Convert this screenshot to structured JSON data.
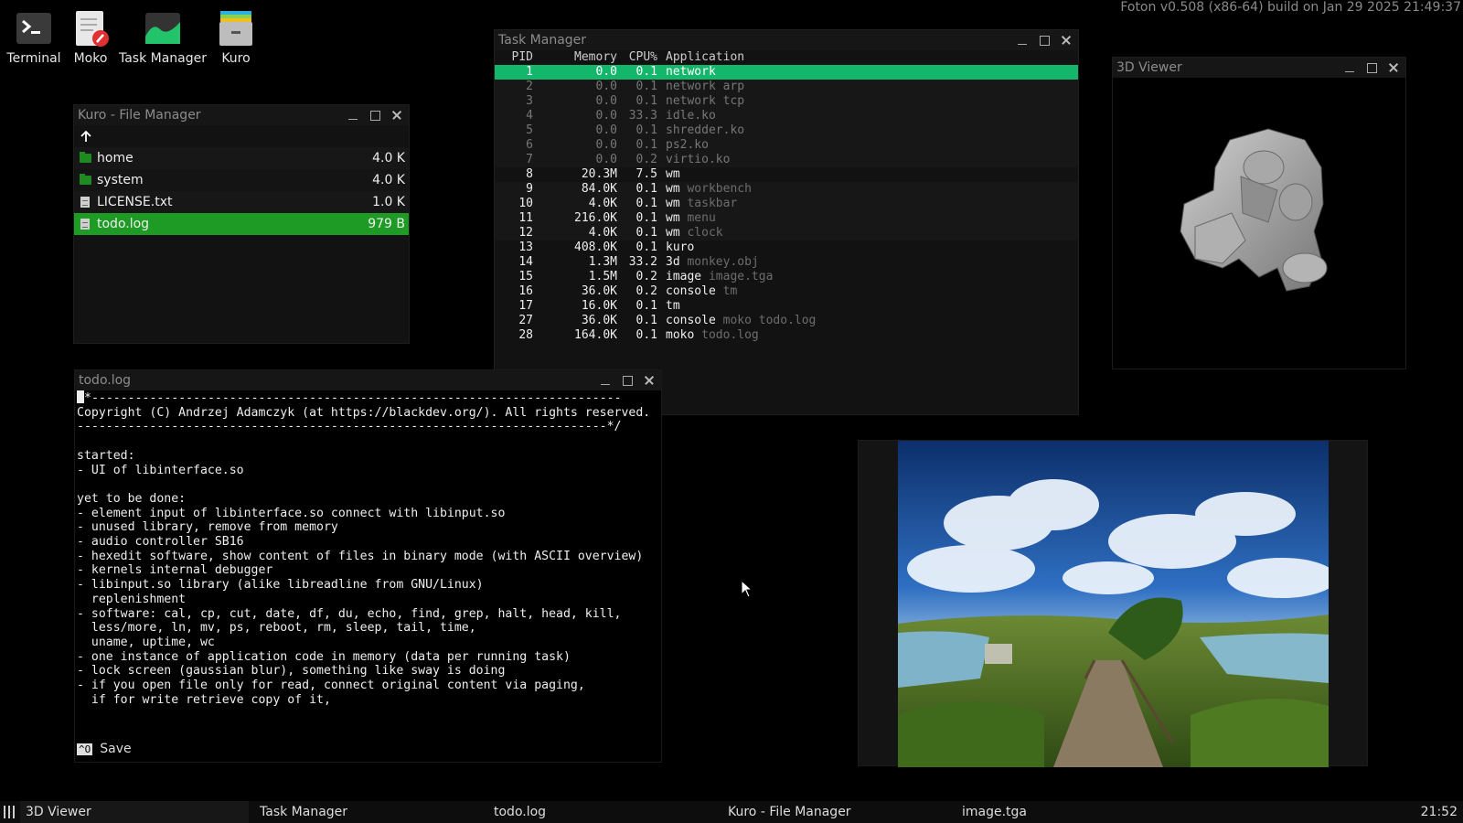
{
  "system_info": "Foton v0.508 (x86-64) build on Jan 29 2025 21:49:37",
  "desktop_icons": [
    {
      "label": "Terminal",
      "icon": "terminal-icon"
    },
    {
      "label": "Moko",
      "icon": "text-editor-icon"
    },
    {
      "label": "Task Manager",
      "icon": "task-manager-icon"
    },
    {
      "label": "Kuro",
      "icon": "file-manager-icon"
    }
  ],
  "file_manager": {
    "title": "Kuro - File Manager",
    "up_icon": "arrow-up-icon",
    "rows": [
      {
        "name": "home",
        "size": "4.0 K",
        "type": "folder"
      },
      {
        "name": "system",
        "size": "4.0 K",
        "type": "folder"
      },
      {
        "name": "LICENSE.txt",
        "size": "1.0 K",
        "type": "file"
      },
      {
        "name": "todo.log",
        "size": "979 B",
        "type": "file",
        "selected": true
      }
    ]
  },
  "task_manager": {
    "title": "Task Manager",
    "headers": {
      "pid": "PID",
      "memory": "Memory",
      "cpu": "CPU%",
      "app": "Application"
    },
    "rows": [
      {
        "pid": "1",
        "mem": "0.0",
        "cpu": "0.1",
        "app": "network",
        "arg": "",
        "state": "sel"
      },
      {
        "pid": "2",
        "mem": "0.0",
        "cpu": "0.1",
        "app": "network arp",
        "arg": "",
        "state": "dim"
      },
      {
        "pid": "3",
        "mem": "0.0",
        "cpu": "0.1",
        "app": "network tcp",
        "arg": "",
        "state": "dim"
      },
      {
        "pid": "4",
        "mem": "0.0",
        "cpu": "33.3",
        "app": "idle.ko",
        "arg": "",
        "state": "dim"
      },
      {
        "pid": "5",
        "mem": "0.0",
        "cpu": "0.1",
        "app": "shredder.ko",
        "arg": "",
        "state": "dim"
      },
      {
        "pid": "6",
        "mem": "0.0",
        "cpu": "0.1",
        "app": "ps2.ko",
        "arg": "",
        "state": "dim"
      },
      {
        "pid": "7",
        "mem": "0.0",
        "cpu": "0.2",
        "app": "virtio.ko",
        "arg": "",
        "state": "dim"
      },
      {
        "pid": "8",
        "mem": "20.3M",
        "cpu": "7.5",
        "app": "wm",
        "arg": "",
        "state": ""
      },
      {
        "pid": "9",
        "mem": "84.0K",
        "cpu": "0.1",
        "app": "wm",
        "arg": "workbench",
        "state": "shade"
      },
      {
        "pid": "10",
        "mem": "4.0K",
        "cpu": "0.1",
        "app": "wm",
        "arg": "taskbar",
        "state": "shade"
      },
      {
        "pid": "11",
        "mem": "216.0K",
        "cpu": "0.1",
        "app": "wm",
        "arg": "menu",
        "state": "shade"
      },
      {
        "pid": "12",
        "mem": "4.0K",
        "cpu": "0.1",
        "app": "wm",
        "arg": "clock",
        "state": "shade"
      },
      {
        "pid": "13",
        "mem": "408.0K",
        "cpu": "0.1",
        "app": "kuro",
        "arg": "",
        "state": ""
      },
      {
        "pid": "14",
        "mem": "1.3M",
        "cpu": "33.2",
        "app": "3d",
        "arg": "monkey.obj",
        "state": ""
      },
      {
        "pid": "15",
        "mem": "1.5M",
        "cpu": "0.2",
        "app": "image",
        "arg": "image.tga",
        "state": ""
      },
      {
        "pid": "16",
        "mem": "36.0K",
        "cpu": "0.2",
        "app": "console",
        "arg": "tm",
        "state": ""
      },
      {
        "pid": "17",
        "mem": "16.0K",
        "cpu": "0.1",
        "app": "tm",
        "arg": "",
        "state": ""
      },
      {
        "pid": "27",
        "mem": "36.0K",
        "cpu": "0.1",
        "app": "console",
        "arg": "moko todo.log",
        "state": ""
      },
      {
        "pid": "28",
        "mem": "164.0K",
        "cpu": "0.1",
        "app": "moko",
        "arg": "todo.log",
        "state": ""
      }
    ]
  },
  "viewer_3d": {
    "title": "3D Viewer"
  },
  "editor": {
    "title": "todo.log",
    "lines": [
      "*-------------------------------------------------------------------------",
      "Copyright (C) Andrzej Adamczyk (at https://blackdev.org/). All rights reserved.",
      "-------------------------------------------------------------------------*/",
      "",
      "started:",
      "- UI of libinterface.so",
      "",
      "yet to be done:",
      "- element input of libinterface.so connect with libinput.so",
      "- unused library, remove from memory",
      "- audio controller SB16",
      "- hexedit software, show content of files in binary mode (with ASCII overview)",
      "- kernels internal debugger",
      "- libinput.so library (alike libreadline from GNU/Linux)",
      "  replenishment",
      "- software: cal, cp, cut, date, df, du, echo, find, grep, halt, head, kill,",
      "  less/more, ln, mv, ps, reboot, rm, sleep, tail, time,",
      "  uname, uptime, wc",
      "- one instance of application code in memory (data per running task)",
      "- lock screen (gaussian blur), something like sway is doing",
      "- if you open file only for read, connect original content via paging,",
      "  if for write retrieve copy of it,"
    ],
    "cursor_char": "/",
    "shortcut_key": "^O",
    "shortcut_label": "Save"
  },
  "image_viewer": {
    "subject": "landscape-painting-image"
  },
  "taskbar": {
    "menu_icon": "menu-icon",
    "tasks": [
      "3D Viewer",
      "Task Manager",
      "todo.log",
      "Kuro - File Manager",
      "image.tga"
    ],
    "clock": "21:52"
  },
  "colors": {
    "accent_green": "#1e9b25",
    "taskmanager_select": "#14b66c",
    "background": "#000000"
  }
}
